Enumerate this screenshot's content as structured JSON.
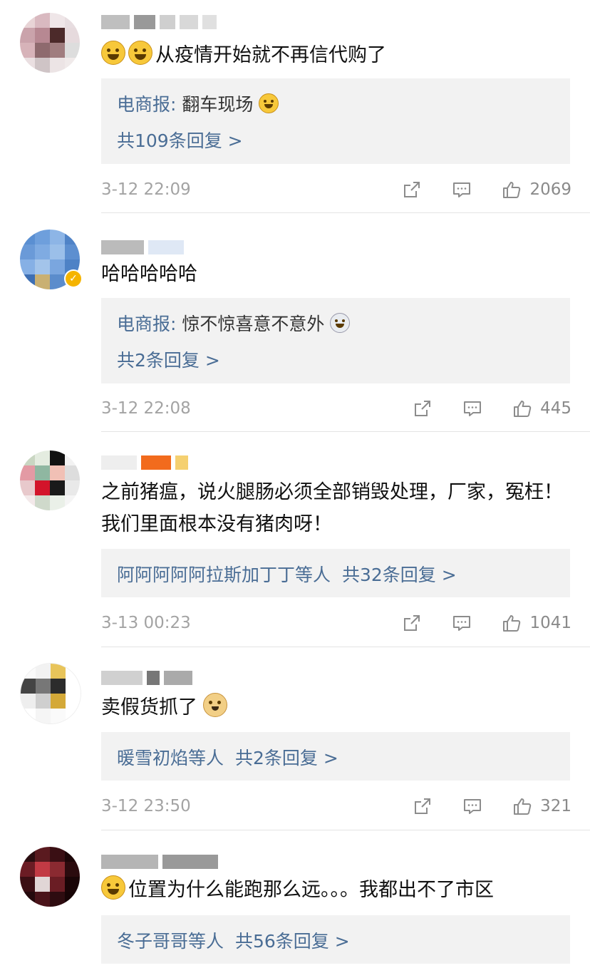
{
  "comments": [
    {
      "text": "从疫情开始就不再信代购了",
      "emojis": [
        "laugh-cry-emoji",
        "laugh-cry-emoji"
      ],
      "reply_author": "电商报",
      "reply_text": "翻车现场",
      "reply_emoji": "laugh-cry-emoji",
      "reply_count": "共109条回复 >",
      "time": "3-12 22:09",
      "likes": "2069"
    },
    {
      "text": "哈哈哈哈哈",
      "reply_author": "电商报",
      "reply_text": "惊不惊喜意不意外",
      "reply_emoji": "surprised-emoji",
      "reply_count": "共2条回复 >",
      "time": "3-12 22:08",
      "likes": "445"
    },
    {
      "text": "之前猪瘟，说火腿肠必须全部销毁处理，厂家，冤枉！我们里面根本没有猪肉呀！",
      "reply_people": "阿阿阿阿阿拉斯加丁丁等人",
      "reply_count": "共32条回复 >",
      "time": "3-13 00:23",
      "likes": "1041"
    },
    {
      "text": "卖假货抓了",
      "emoji_after": "doge-emoji",
      "reply_people": "暖雪初焰等人",
      "reply_count": "共2条回复 >",
      "time": "3-12 23:50",
      "likes": "321"
    },
    {
      "text": "位置为什么能跑那么远。。。我都出不了市区",
      "emojis": [
        "sweat-emoji"
      ],
      "reply_people": "冬子哥哥等人",
      "reply_count": "共56条回复 >"
    }
  ],
  "icons": {
    "share": "share-icon",
    "comment": "comment-icon",
    "like": "thumb-up-icon"
  },
  "colors": {
    "link_blue": "#4a6d95",
    "time_gray": "#a3a3a3",
    "reply_bg": "#f2f2f2"
  }
}
